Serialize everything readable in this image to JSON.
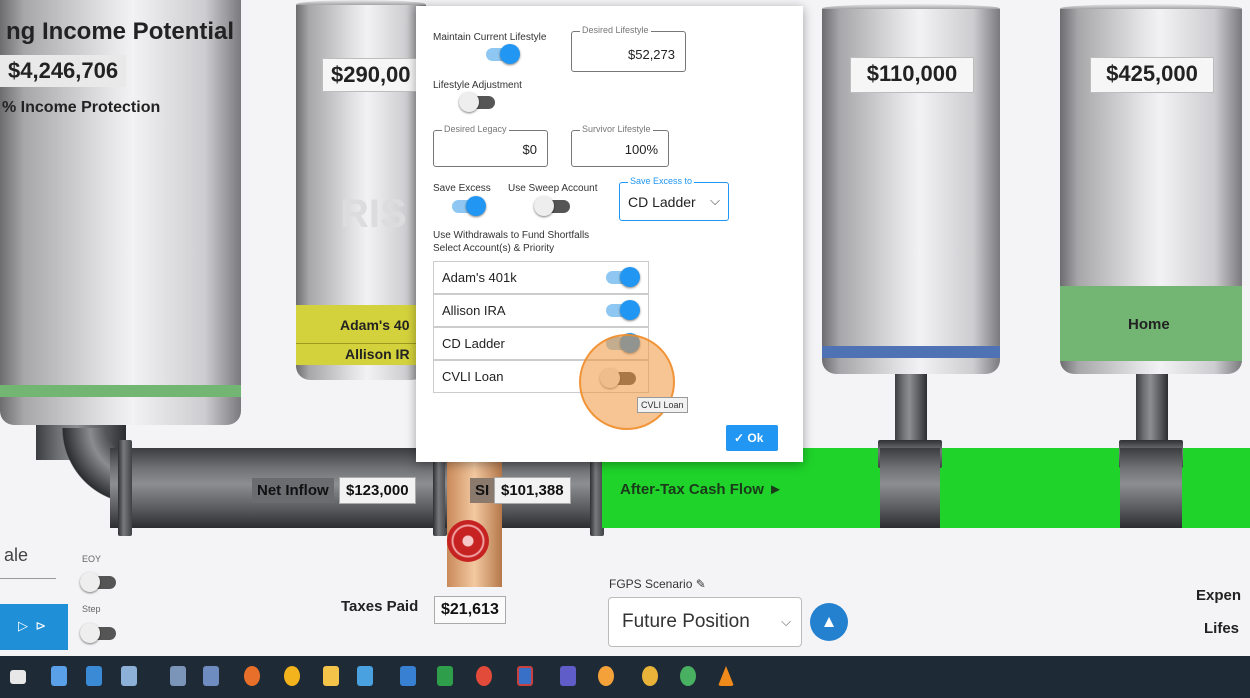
{
  "left_panel": {
    "title": "ng Income Potential",
    "value": "$4,246,706",
    "subtitle": "% Income Protection"
  },
  "tanks": {
    "tank2": {
      "value": "$290,00",
      "fill_labels": [
        "Adam's 40",
        "Allison IR"
      ],
      "watermark": "RIS"
    },
    "tank3": {
      "value": "$110,000"
    },
    "tank4": {
      "value": "$425,000",
      "fill_label": "Home"
    }
  },
  "pipeline": {
    "net_inflow_label": "Net Inflow",
    "net_inflow_value": "$123,000",
    "si_label": "SI",
    "si_value": "$101,388",
    "after_tax_label": "After-Tax Cash Flow ►",
    "taxes_paid_label": "Taxes Paid",
    "taxes_paid_value": "$21,613"
  },
  "bottom_controls": {
    "left_partial": "ale",
    "eoy_label": "EOY",
    "step_label": "Step",
    "fgps_label": "FGPS Scenario",
    "fgps_value": "Future Position",
    "right_line1": "Expen",
    "right_line2": "Lifes"
  },
  "modal": {
    "maintain_lifestyle_label": "Maintain Current Lifestyle",
    "desired_lifestyle_legend": "Desired Lifestyle",
    "desired_lifestyle_value": "$52,273",
    "lifestyle_adjustment_label": "Lifestyle Adjustment",
    "desired_legacy_legend": "Desired Legacy",
    "desired_legacy_value": "$0",
    "survivor_lifestyle_legend": "Survivor Lifestyle",
    "survivor_lifestyle_value": "100%",
    "save_excess_label": "Save Excess",
    "sweep_label": "Use Sweep Account",
    "save_excess_to_legend": "Save Excess to",
    "save_excess_to_value": "CD Ladder",
    "withdrawals_line1": "Use Withdrawals to Fund Shortfalls",
    "withdrawals_line2": "Select Account(s) & Priority",
    "accounts": [
      {
        "name": "Adam's 401k",
        "enabled": true
      },
      {
        "name": "Allison IRA",
        "enabled": true
      },
      {
        "name": "CD Ladder",
        "enabled": true
      },
      {
        "name": "CVLI Loan",
        "enabled": false
      }
    ],
    "tooltip": "CVLI Loan",
    "ok_label": "Ok"
  },
  "toggles": {
    "maintain": true,
    "lifestyle_adj": false,
    "save_excess": true,
    "sweep": false,
    "eoy": false,
    "step": false
  },
  "colors": {
    "accent": "#2196f3",
    "flow_green": "#1fd32a",
    "highlight": "#f0a04b"
  }
}
